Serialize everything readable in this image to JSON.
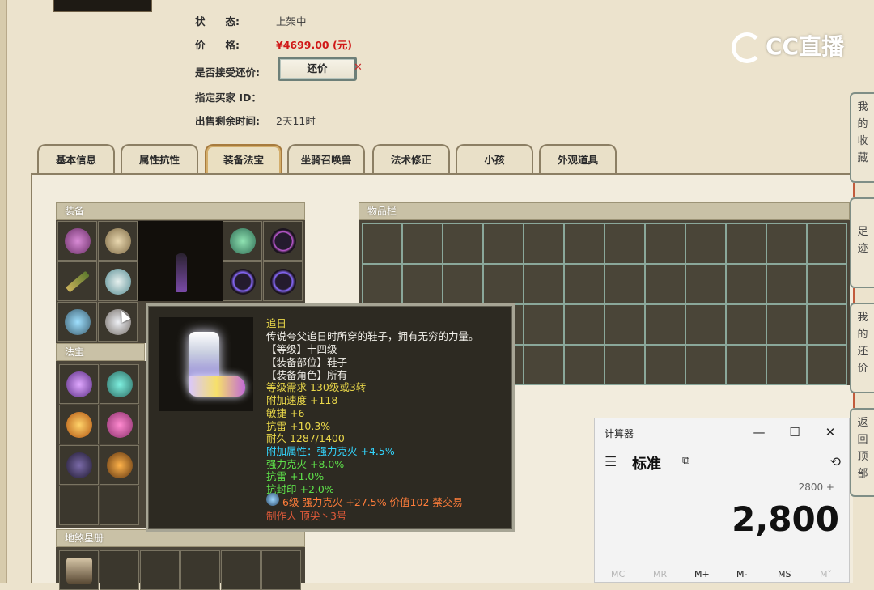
{
  "listing": {
    "status_label": "状　　态:",
    "status_value": "上架中",
    "price_label": "价　　格:",
    "price_value": "¥4699.00 (元)",
    "bargain_label": "是否接受还价:",
    "bargain_button": "还价",
    "buyer_label": "指定买家 ID：",
    "remain_label": "出售剩余时间:",
    "remain_value": "2天11时"
  },
  "watermark": {
    "text": "CC直播"
  },
  "tabs": [
    "基本信息",
    "属性抗性",
    "装备法宝",
    "坐骑召唤兽",
    "法术修正",
    "小孩",
    "外观道具"
  ],
  "active_tab": "装备法宝",
  "sections": {
    "equip": "装备",
    "fabao": "法宝",
    "dishaxing": "地煞星册",
    "inventory": "物品栏"
  },
  "tooltip": {
    "name": "追日",
    "desc": "传说夸父追日时所穿的鞋子，拥有无穷的力量。",
    "level": "【等级】十四级",
    "slot": "【装备部位】鞋子",
    "role": "【装备角色】所有",
    "req": "等级需求 130级或3转",
    "speed": "附加速度 +118",
    "agility": "敏捷 +6",
    "resist_thunder": "抗雷 +10.3%",
    "durability": "耐久 1287/1400",
    "extra_attr": "附加属性：强力克火 +4.5%",
    "strong_fire": "强力克火 +8.0%",
    "resist_thunder2": "抗雷 +1.0%",
    "resist_seal": "抗封印 +2.0%",
    "gem": "6级 强力克火 +27.5% 价值102 禁交易",
    "maker": "制作人 顶尖丶3号"
  },
  "calculator": {
    "title": "计算器",
    "mode": "标准",
    "expression": "2800 +",
    "display": "2,800",
    "memory": [
      "MC",
      "MR",
      "M+",
      "M-",
      "MS",
      "M˅"
    ],
    "minimize": "—",
    "maximize": "☐",
    "close": "✕",
    "menu_icon": "☰",
    "pin_icon": "⧉",
    "history_icon": "⟲"
  },
  "side_tabs": [
    "我的收藏",
    "足迹",
    "我的还价",
    "返回顶部"
  ],
  "colors": {
    "price": "#d01818",
    "panel_bg": "#f2ecdd",
    "tooltip_bg": "#2d2a22"
  }
}
